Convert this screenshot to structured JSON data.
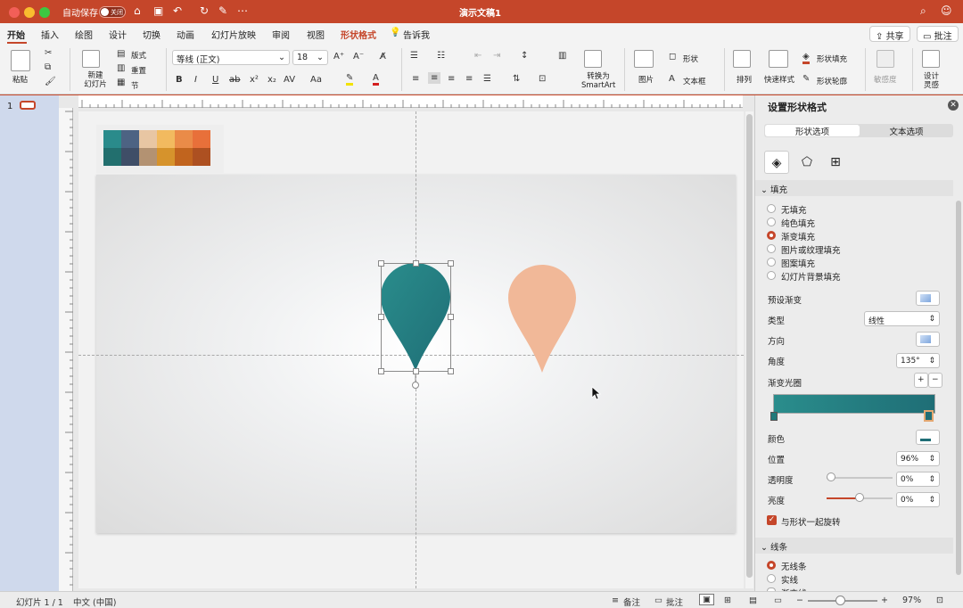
{
  "titlebar": {
    "autosave_label": "自动保存",
    "autosave_state": "关闭",
    "doc_title": "演示文稿1"
  },
  "tabs": [
    "开始",
    "插入",
    "绘图",
    "设计",
    "切换",
    "动画",
    "幻灯片放映",
    "审阅",
    "视图",
    "形状格式",
    "告诉我"
  ],
  "header_buttons": {
    "share": "共享",
    "comment": "批注"
  },
  "ribbon": {
    "paste": "粘贴",
    "new_slide": "新建\n幻灯片",
    "layout": "版式",
    "reset": "重置",
    "section": "节",
    "font_name": "等线 (正文)",
    "font_size": "18",
    "picture": "图片",
    "shapes": "形状",
    "textbox": "文本框",
    "arrange": "排列",
    "quick_styles": "快速样式",
    "shape_fill": "形状填充",
    "shape_outline": "形状轮廓",
    "sensitivity": "敏感度",
    "designer": "设计\n灵感",
    "smartart": "转换为\nSmartArt"
  },
  "left_panel": {
    "slide_number": "1"
  },
  "palette": {
    "top": [
      "#2a8b8b",
      "#4d6383",
      "#e8c6a3",
      "#f2ba5f",
      "#ea8b48",
      "#e8703a"
    ],
    "bottom": [
      "#226f6e",
      "#3f4e67",
      "#b39272",
      "#d6932c",
      "#c1641e",
      "#ad5021"
    ]
  },
  "shapes": {
    "teal_top": "#2a8d8c",
    "teal_bottom": "#1f6e76",
    "peach": "#f1b898"
  },
  "panel": {
    "title": "设置形状格式",
    "tab_shape": "形状选项",
    "tab_text": "文本选项",
    "fill_section": "填充",
    "fill_options": [
      "无填充",
      "纯色填充",
      "渐变填充",
      "图片或纹理填充",
      "图案填充",
      "幻灯片背景填充"
    ],
    "selected_fill": "渐变填充",
    "preset_gradient": "预设渐变",
    "type_label": "类型",
    "type_value": "线性",
    "direction_label": "方向",
    "angle_label": "角度",
    "angle_value": "135°",
    "gradient_stops": "渐变光圈",
    "color_label": "颜色",
    "position_label": "位置",
    "position_value": "96%",
    "transparency_label": "透明度",
    "transparency_value": "0%",
    "brightness_label": "亮度",
    "brightness_value": "0%",
    "rotate_with_shape": "与形状一起旋转",
    "line_section": "线条",
    "line_options": [
      "无线条",
      "实线",
      "渐变线"
    ],
    "selected_line": "无线条"
  },
  "statusbar": {
    "slide_info": "幻灯片 1 / 1",
    "language": "中文 (中国)",
    "notes": "备注",
    "comments": "批注",
    "zoom": "97%"
  }
}
